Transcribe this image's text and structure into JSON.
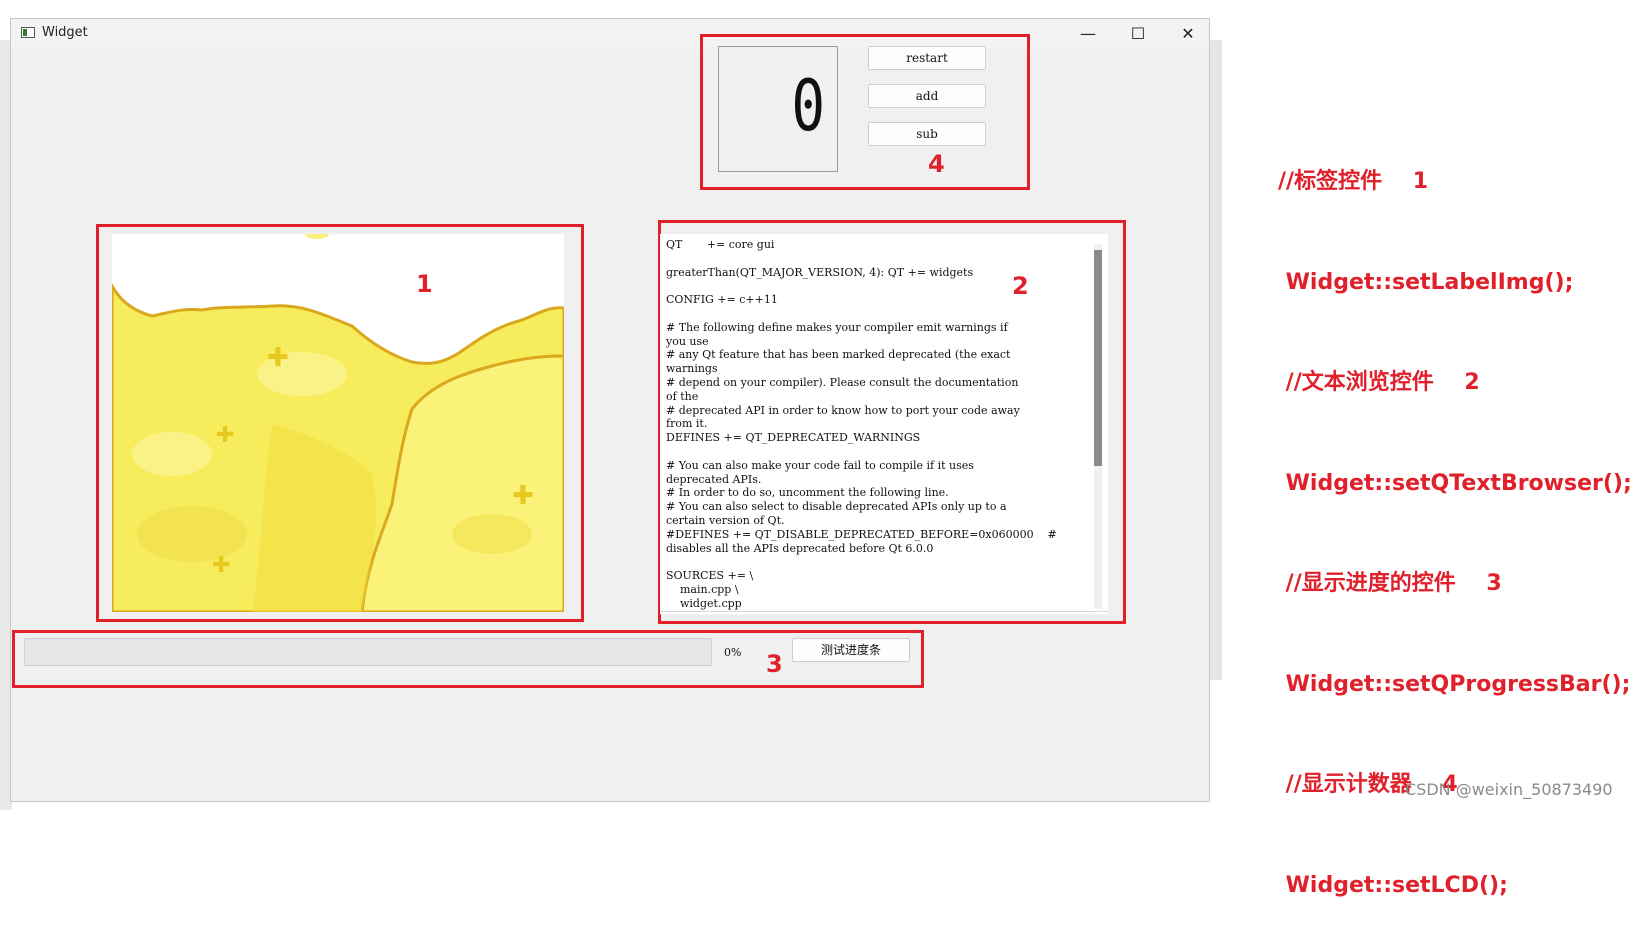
{
  "window": {
    "title": "Widget",
    "controls": {
      "minimize": "—",
      "maximize": "☐",
      "close": "✕"
    }
  },
  "lcd": {
    "value": "0"
  },
  "buttons": {
    "restart": "restart",
    "add": "add",
    "sub": "sub",
    "test_progress": "测试进度条"
  },
  "text_browser": {
    "content": "QT       += core gui\n\ngreaterThan(QT_MAJOR_VERSION, 4): QT += widgets\n\nCONFIG += c++11\n\n# The following define makes your compiler emit warnings if\nyou use\n# any Qt feature that has been marked deprecated (the exact\nwarnings\n# depend on your compiler). Please consult the documentation\nof the\n# deprecated API in order to know how to port your code away\nfrom it.\nDEFINES += QT_DEPRECATED_WARNINGS\n\n# You can also make your code fail to compile if it uses\ndeprecated APIs.\n# In order to do so, uncomment the following line.\n# You can also select to disable deprecated APIs only up to a\ncertain version of Qt.\n#DEFINES += QT_DISABLE_DEPRECATED_BEFORE=0x060000    #\ndisables all the APIs deprecated before Qt 6.0.0\n\nSOURCES += \\\n    main.cpp \\\n    widget.cpp"
  },
  "progress": {
    "value": 0,
    "text": "0%"
  },
  "markers": {
    "one": "1",
    "two": "2",
    "three": "3",
    "four": "4"
  },
  "annotations": {
    "lines": [
      "//标签控件    1",
      " Widget::setLabelImg();",
      " //文本浏览控件    2",
      " Widget::setQTextBrowser();",
      " //显示进度的控件    3",
      " Widget::setQProgressBar();",
      " //显示计数器    4",
      " Widget::setLCD();"
    ]
  },
  "watermark": "CSDN @weixin_50873490",
  "colors": {
    "annotation_red": "#e0202a",
    "window_bg": "#f0f0f0",
    "image_yellow": "#f7ec5c",
    "image_outline": "#d9a81c"
  }
}
